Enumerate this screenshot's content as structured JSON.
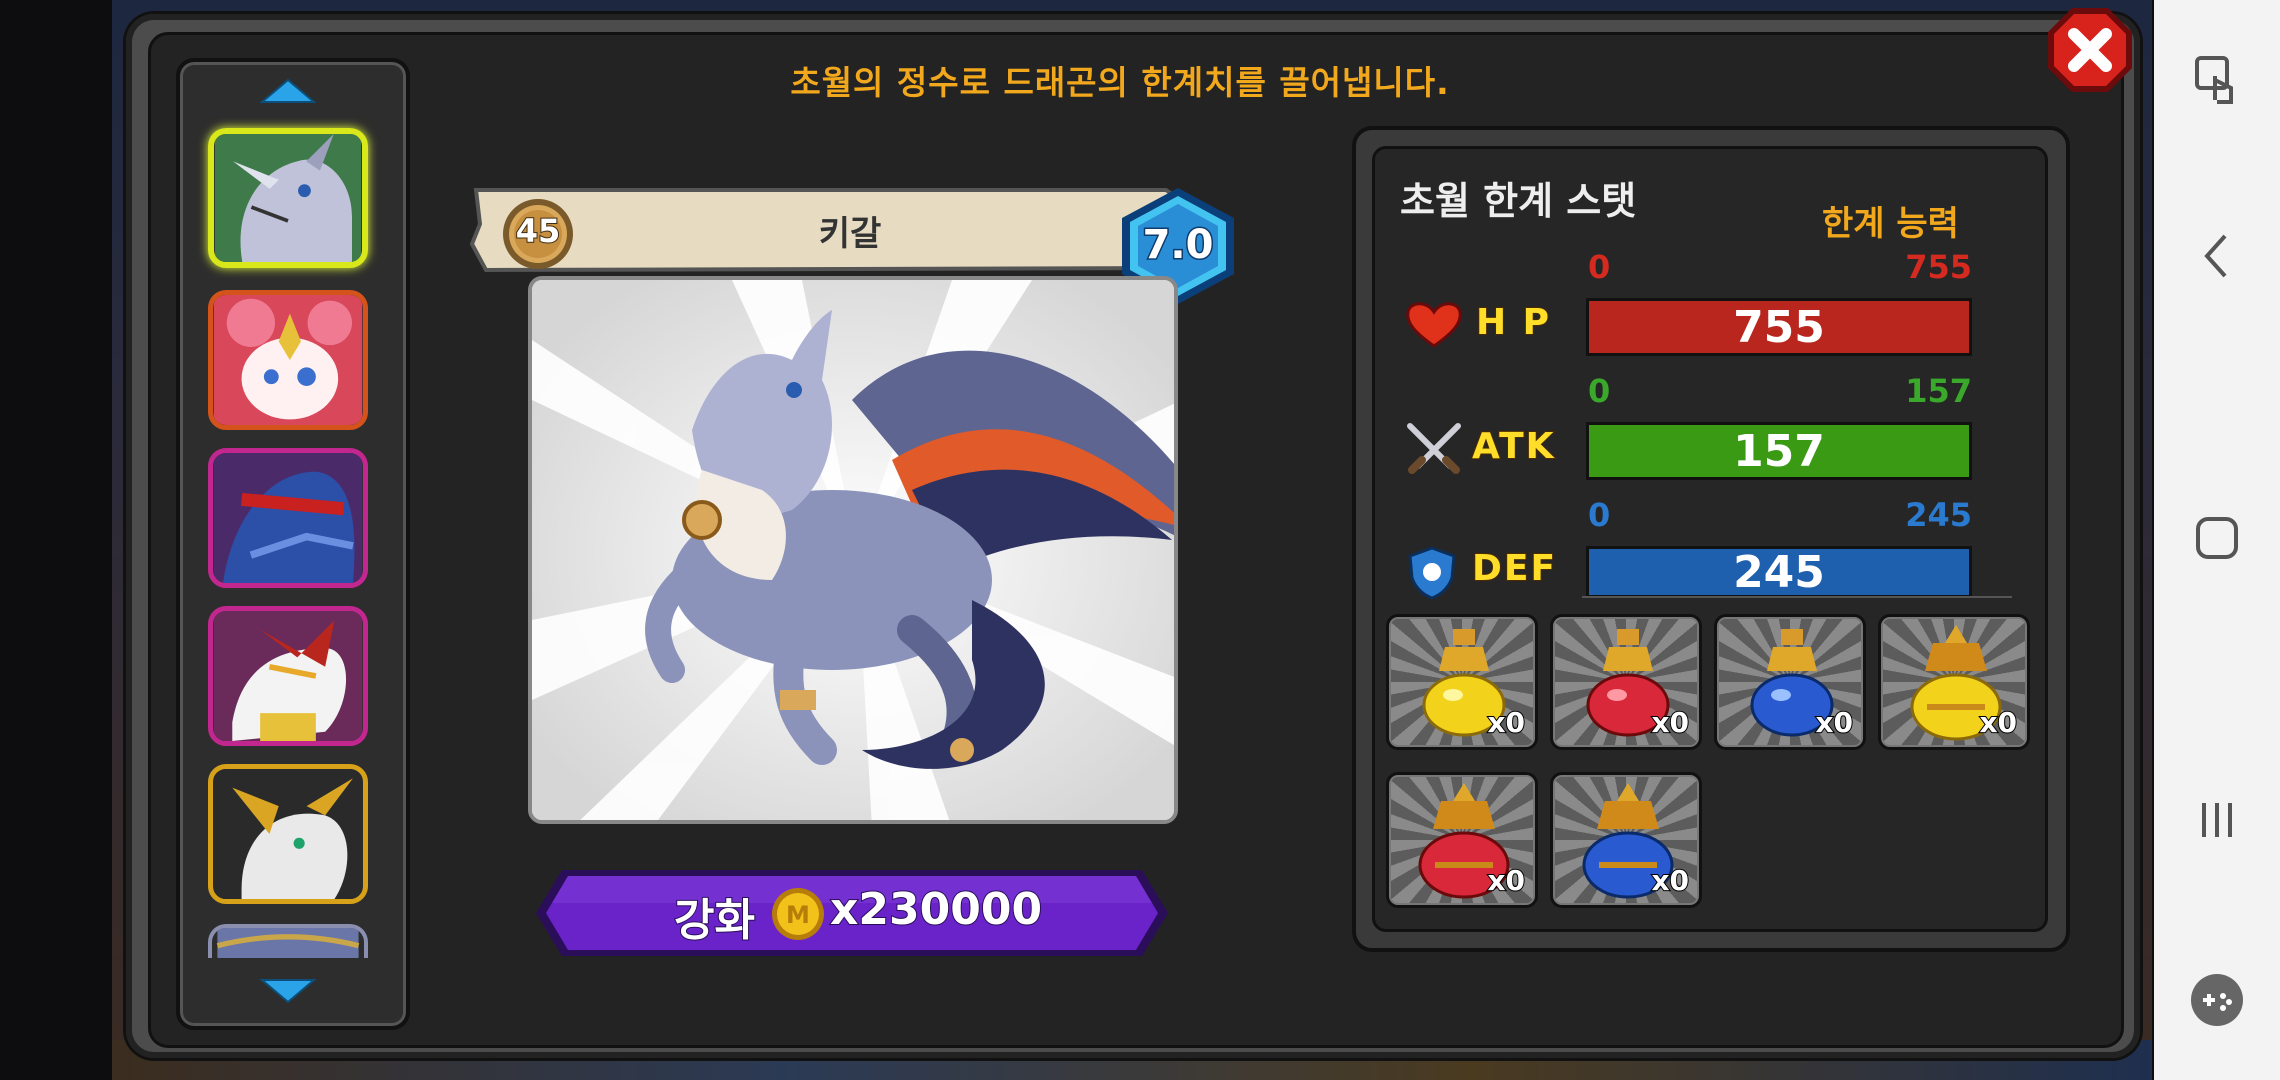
{
  "header": {
    "description": "초월의 정수로 드래곤의 한계치를 끌어냅니다."
  },
  "dragon": {
    "level": "45",
    "name": "키갈",
    "grade": "7.0"
  },
  "upgrade": {
    "label": "강화",
    "cost": "x230000"
  },
  "stats": {
    "title": "초월 한계 스탯",
    "subtitle": "한계 능력",
    "rows": [
      {
        "name": "H P",
        "min": "0",
        "max": "755",
        "value": "755",
        "color": "#b9261e",
        "fill": 1.0
      },
      {
        "name": "ATK",
        "min": "0",
        "max": "157",
        "value": "157",
        "color": "#3a9a14",
        "fill": 1.0
      },
      {
        "name": "DEF",
        "min": "0",
        "max": "245",
        "value": "245",
        "color": "#1e5fae",
        "fill": 1.0
      }
    ]
  },
  "potions": [
    {
      "color": "yellow",
      "count": "x0"
    },
    {
      "color": "red",
      "count": "x0"
    },
    {
      "color": "blue",
      "count": "x0"
    },
    {
      "color": "gold-large",
      "count": "x0"
    },
    {
      "color": "red-large",
      "count": "x0"
    },
    {
      "color": "blue-large",
      "count": "x0"
    }
  ],
  "dragon_list": [
    {
      "name": "grey-wolf-dragon",
      "border": "#d9e81a",
      "selected": true
    },
    {
      "name": "pink-flower-dragon",
      "border": "#d4531a"
    },
    {
      "name": "blue-armored-dragon",
      "border": "#c1278f"
    },
    {
      "name": "white-red-dragon",
      "border": "#c1278f"
    },
    {
      "name": "gold-white-dragon",
      "border": "#d7a11a"
    }
  ],
  "icons": {
    "close": "close-icon",
    "up": "arrow-up-icon",
    "down": "arrow-down-icon",
    "hp": "heart-icon",
    "atk": "crossed-swords-icon",
    "def": "shield-icon",
    "coin": "gold-coin-icon"
  }
}
